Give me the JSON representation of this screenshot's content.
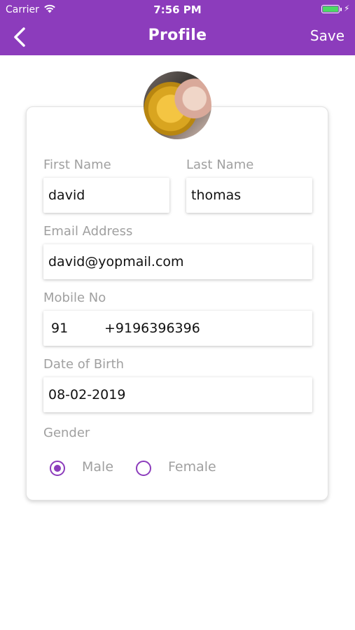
{
  "status_bar": {
    "carrier": "Carrier",
    "time": "7:56 PM"
  },
  "header": {
    "title": "Profile",
    "save_label": "Save"
  },
  "form": {
    "first_name": {
      "label": "First Name",
      "value": "david"
    },
    "last_name": {
      "label": "Last Name",
      "value": "thomas"
    },
    "email": {
      "label": "Email Address",
      "value": "david@yopmail.com"
    },
    "mobile": {
      "label": "Mobile No",
      "country_code": "91",
      "number": "+9196396396"
    },
    "dob": {
      "label": "Date of Birth",
      "value": "08-02-2019"
    },
    "gender": {
      "label": "Gender",
      "options": [
        {
          "label": "Male",
          "selected": true
        },
        {
          "label": "Female",
          "selected": false
        }
      ]
    }
  },
  "colors": {
    "accent": "#8c3cbc",
    "label": "#a0a0a0",
    "battery": "#4cd964"
  },
  "icons": [
    "wifi-icon",
    "battery-icon",
    "charging-icon",
    "back-chevron-icon"
  ]
}
